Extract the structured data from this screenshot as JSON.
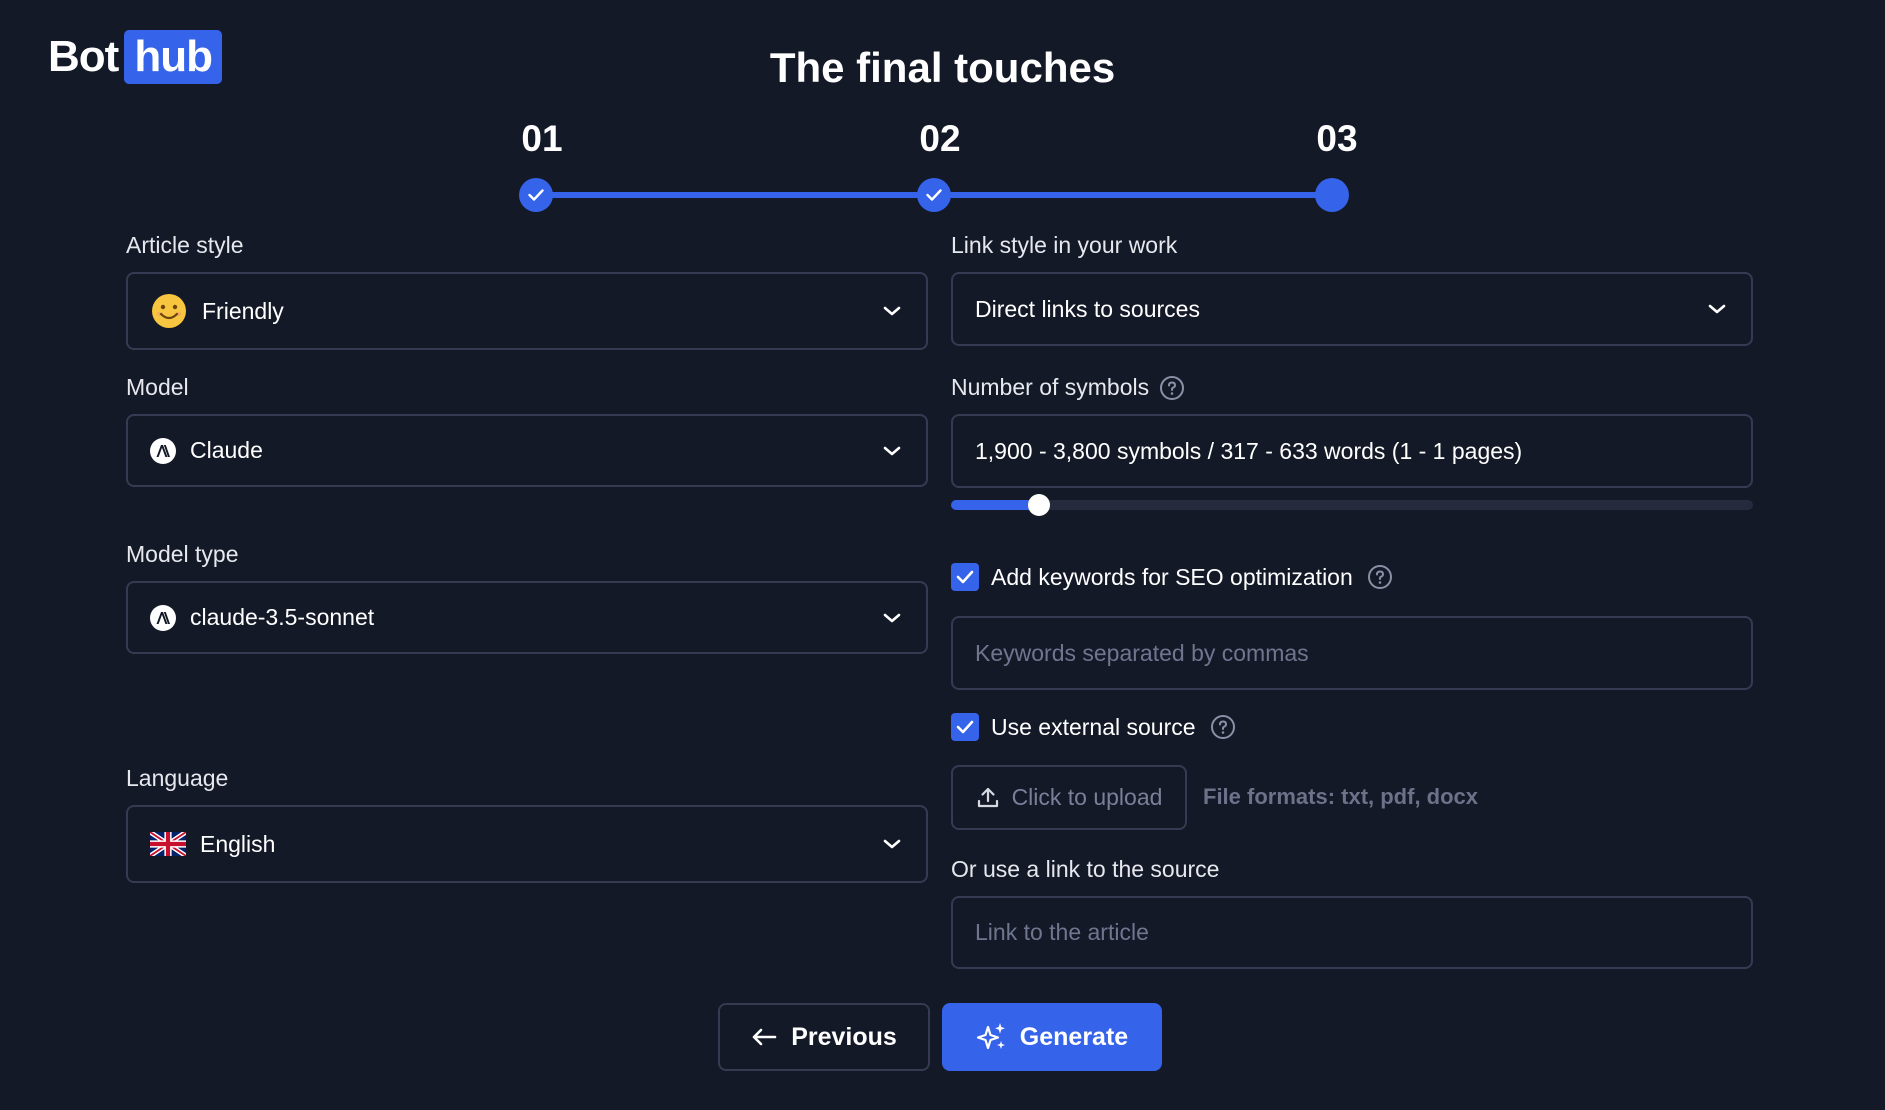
{
  "logo": {
    "part1": "Bot",
    "part2": "hub"
  },
  "title": "The final touches",
  "steps": [
    {
      "number": "01",
      "state": "completed"
    },
    {
      "number": "02",
      "state": "completed"
    },
    {
      "number": "03",
      "state": "current"
    }
  ],
  "left": {
    "article_style": {
      "label": "Article style",
      "value": "Friendly",
      "icon": "smiley-emoji-icon"
    },
    "model": {
      "label": "Model",
      "value": "Claude",
      "icon": "anthropic-logo-icon"
    },
    "model_type": {
      "label": "Model type",
      "value": "claude-3.5-sonnet",
      "icon": "anthropic-logo-icon"
    },
    "language": {
      "label": "Language",
      "value": "English",
      "icon": "uk-flag-icon"
    }
  },
  "right": {
    "link_style": {
      "label": "Link style in your work",
      "value": "Direct links to sources"
    },
    "symbols": {
      "label": "Number of symbols",
      "value": "1,900 - 3,800 symbols / 317 - 633 words (1 - 1 pages)",
      "slider_fraction": 0.11
    },
    "seo": {
      "label": "Add keywords for SEO optimization",
      "checked": true,
      "placeholder": "Keywords separated by commas"
    },
    "external_source": {
      "label": "Use external source",
      "checked": true,
      "upload_label": "Click to upload",
      "formats": "File formats: txt, pdf, docx"
    },
    "link_source": {
      "label": "Or use a link to the source",
      "placeholder": "Link to the article"
    }
  },
  "buttons": {
    "previous": "Previous",
    "generate": "Generate"
  },
  "colors": {
    "background": "#141927",
    "accent": "#3563e9",
    "border": "#353b52",
    "muted_text": "#6f7690"
  }
}
